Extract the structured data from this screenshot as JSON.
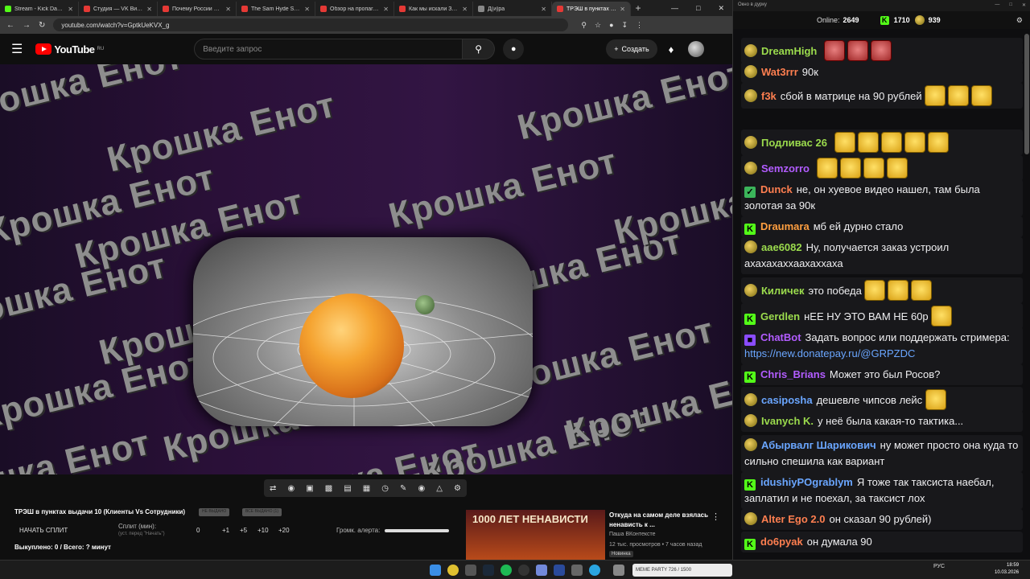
{
  "browser": {
    "tabs": [
      {
        "label": "Stream - Kick Dashboard",
        "color": "#53fc18"
      },
      {
        "label": "Студия — VK Видео Live",
        "color": "#e53935"
      },
      {
        "label": "Почему России не дали",
        "color": "#e53935"
      },
      {
        "label": "The Sam Hyde Show: E",
        "color": "#e53935"
      },
      {
        "label": "Обзор на пропаганду",
        "color": "#e53935"
      },
      {
        "label": "Как мы искали ЗОЛОТ",
        "color": "#e53935"
      },
      {
        "label": "Д(и)ра",
        "color": "#888888"
      },
      {
        "label": "ТРЭШ в пунктах выдачи",
        "color": "#e53935"
      }
    ],
    "new_tab": "+",
    "url": "youtube.com/watch?v=GptkUeKVX_g"
  },
  "youtube": {
    "logo": "YouTube",
    "region": "RU",
    "search_placeholder": "Введите запрос",
    "create_label": "Создать"
  },
  "video": {
    "background_word": "Крошка Енот"
  },
  "panel": {
    "title": "ТРЭШ в пунктах выдачи 10 (Клиенты Vs Сотрудники)",
    "chip1": "НЕ ВЫДАНО",
    "chip2": "ВСЕ ВЫДАНО (1)",
    "split_button": "НАЧАТЬ СПЛИТ",
    "split_label": "Сплит (мин):",
    "split_sub": "(уст. перед \"Начать\")",
    "split_values": [
      "0",
      "+1",
      "+5",
      "+10",
      "+20"
    ],
    "volume_label": "Громк. алерта:",
    "bought": "Выкуплено: 0 / Всего: ? минут"
  },
  "recommended": {
    "thumb_text": "1000 ЛЕТ НЕНАВИСТИ",
    "title": "Откуда на самом деле взялась ненависть к ...",
    "channel": "Паша ВКонтексте",
    "meta": "12 тыс. просмотров • 7 часов назад",
    "badge": "Новинка"
  },
  "chat": {
    "window_title": "Окно в дурку",
    "online_label": "Online:",
    "online": "2649",
    "kick_count": "1710",
    "other_count": "939",
    "messages": [
      {
        "nick": "DreamHigh",
        "color": "#9bdb4d",
        "text": "",
        "badge": "ava",
        "emotes": 3,
        "emote_style": "red"
      },
      {
        "nick": "Wat3rrr",
        "color": "#ff7f50",
        "text": "90к",
        "badge": "ava",
        "emotes": 0
      },
      {
        "nick": "f3k",
        "color": "#ff7f50",
        "text": "сбой в матрице на 90 рублей",
        "badge": "ava",
        "emotes": 3
      },
      {
        "nick": "Подливас 26",
        "color": "#9bdb4d",
        "text": "",
        "badge": "ava",
        "emotes": 5
      },
      {
        "nick": "Semzorro",
        "color": "#b25cff",
        "text": "",
        "badge": "ava",
        "emotes": 4
      },
      {
        "nick": "Dunck",
        "color": "#ff7f50",
        "text": "не, он хуевое видео нашел, там была золотая за 90к",
        "badge": "check",
        "emotes": 0
      },
      {
        "nick": "Draumara",
        "color": "#ff9f40",
        "text": "мб ей дурно стало",
        "badge": "kick",
        "emotes": 0
      },
      {
        "nick": "aae6082",
        "color": "#9bdb4d",
        "text": "Ну, получается заказ устроил ахахахаххаахаххаха",
        "badge": "ava",
        "emotes": 0
      },
      {
        "nick": "Киличек",
        "color": "#9bdb4d",
        "text": "это победа",
        "badge": "ava",
        "emotes": 3
      },
      {
        "nick": "Gerdlen",
        "color": "#9bdb4d",
        "text": "нЕЕ НУ ЭТО ВАМ НЕ 60р",
        "badge": "kick",
        "emotes": 1
      },
      {
        "nick": "ChatBot",
        "color": "#b25cff",
        "text": "Задать вопрос или поддержать стримера:",
        "link": "https://new.donatepay.ru/@GRPZDC",
        "badge": "bot",
        "emotes": 0
      },
      {
        "nick": "Chris_Brians",
        "color": "#b25cff",
        "text": "Может это был Росов?",
        "badge": "kick",
        "emotes": 0
      },
      {
        "nick": "casiposha",
        "color": "#6aa6ff",
        "text": "дешевле чипсов лейс",
        "badge": "ava",
        "emotes": 1
      },
      {
        "nick": "Ivanych K.",
        "color": "#9bdb4d",
        "text": "у неё была какая-то тактика...",
        "badge": "ava",
        "emotes": 0
      },
      {
        "nick": "Абырвалг Шарикович",
        "color": "#6aa6ff",
        "text": "ну может просто она куда то сильно спешила как вариант",
        "badge": "ava",
        "emotes": 0
      },
      {
        "nick": "idushiyPOgrablym",
        "color": "#6aa6ff",
        "text": "Я тоже так таксиста наебал, заплатил и не поехал, за таксист лох",
        "badge": "kick",
        "emotes": 0
      },
      {
        "nick": "Alter Ego 2.0",
        "color": "#ff7f50",
        "text": "он сказал 90 рублей)",
        "badge": "ava",
        "emotes": 0
      },
      {
        "nick": "do6pyak",
        "color": "#ff7f50",
        "text": "он думала 90",
        "badge": "kick",
        "emotes": 0
      }
    ]
  },
  "taskbar": {
    "party_text": "MEME PARTY   726 / 1500",
    "lang": "РУС",
    "time": "18:59",
    "date": "10.03.2026"
  }
}
